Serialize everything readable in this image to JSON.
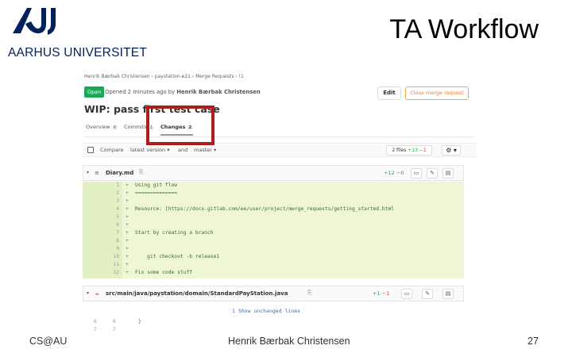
{
  "slide": {
    "logo_text": "AARHUS UNIVERSITET",
    "title": "TA Workflow",
    "footer_left": "CS@AU",
    "footer_center": "Henrik Bærbak Christensen",
    "page_number": "27",
    "accent_color": "#00215d",
    "highlight_color": "#b01c1c"
  },
  "gitlab": {
    "breadcrumb": "Henrik Bærbak Christensen  ›  paystation-e21  ›  Merge Requests  ›  !1",
    "status_badge": "Open",
    "opened_text": "Opened 2 minutes ago by",
    "author": "Henrik Bærbak Christensen",
    "edit_label": "Edit",
    "close_label": "Close merge request",
    "mr_title": "WIP: pass first test case",
    "tabs": [
      {
        "label": "Overview",
        "count": "0"
      },
      {
        "label": "Commits",
        "count": "1"
      },
      {
        "label": "Changes",
        "count": "2"
      }
    ],
    "compare": {
      "compare_label": "Compare",
      "version": "latest version ▾",
      "and_label": "and",
      "target": "master ▾",
      "files_label": "2 files",
      "additions": "+13",
      "deletions": "−1",
      "gear": "⚙ ▾"
    },
    "files": [
      {
        "name": "Diary.md",
        "additions": "+12",
        "deletions": "−0"
      },
      {
        "name": "src/main/java/paystation/domain/StandardPayStation.java",
        "additions": "+1",
        "deletions": "−1"
      }
    ],
    "diff_lines": [
      {
        "n": "1",
        "s": "+",
        "code": "Using git flow"
      },
      {
        "n": "2",
        "s": "+",
        "code": "=============="
      },
      {
        "n": "3",
        "s": "+",
        "code": ""
      },
      {
        "n": "4",
        "s": "+",
        "code": "Resource: [https://docs.gitlab.com/ee/user/project/merge_requests/getting_started.html"
      },
      {
        "n": "5",
        "s": "+",
        "code": ""
      },
      {
        "n": "6",
        "s": "+",
        "code": ""
      },
      {
        "n": "7",
        "s": "+",
        "code": "Start by creating a branch"
      },
      {
        "n": "8",
        "s": "+",
        "code": ""
      },
      {
        "n": "9",
        "s": "+",
        "code": ""
      },
      {
        "n": "10",
        "s": "+",
        "code": "    git checkout -b release1"
      },
      {
        "n": "11",
        "s": "+",
        "code": ""
      },
      {
        "n": "12",
        "s": "+",
        "code": "Fix some code stuff"
      }
    ],
    "unchanged_label": "1  Show unchanged lines",
    "tail": [
      {
        "a": "6",
        "b": "6",
        "code": "}"
      },
      {
        "a": "7",
        "b": "7",
        "code": ""
      }
    ]
  }
}
